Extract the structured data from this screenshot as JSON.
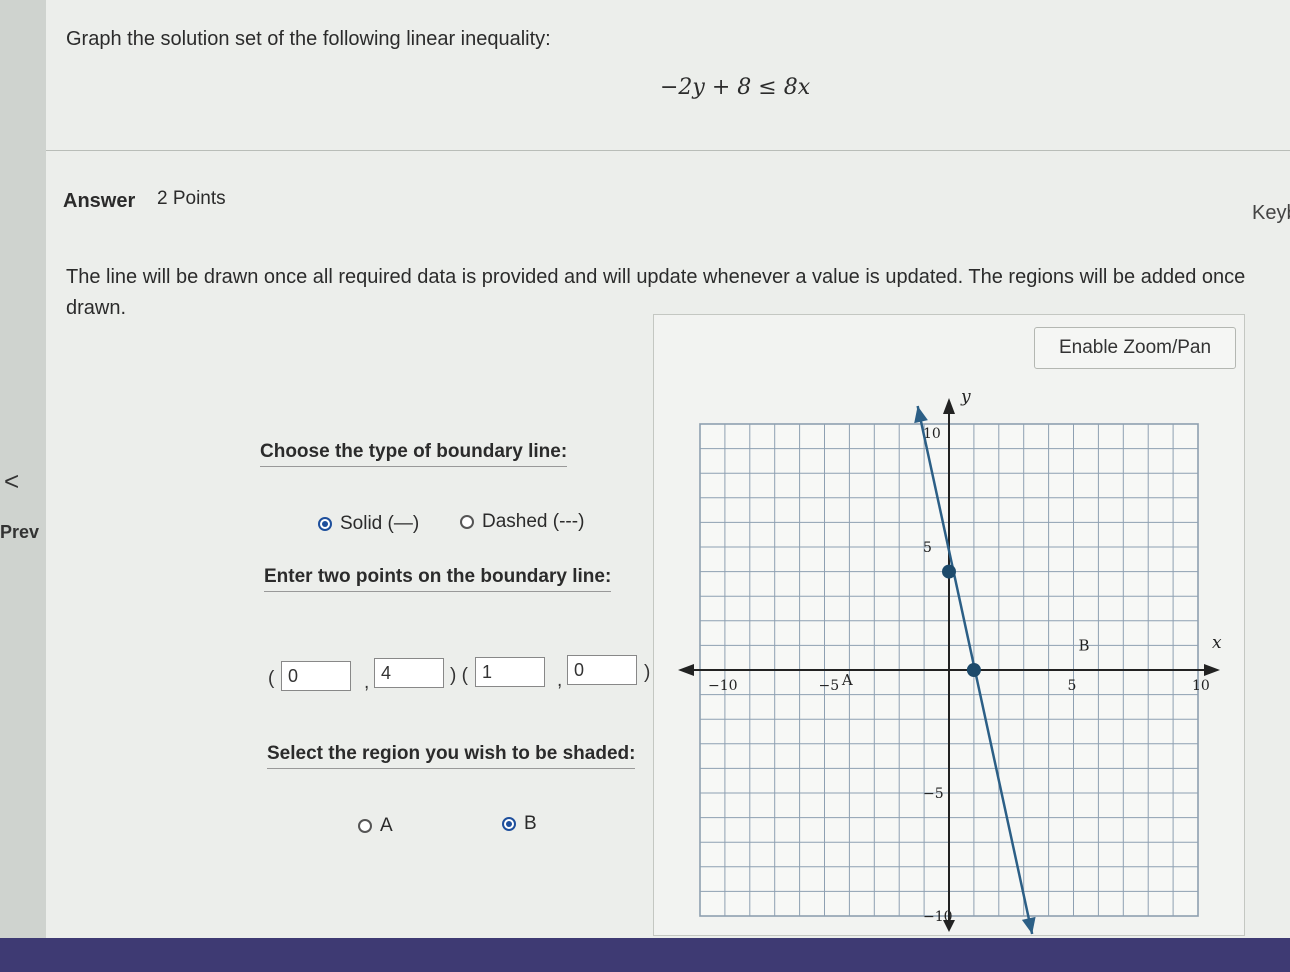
{
  "question": {
    "prompt": "Graph the solution set of the following linear inequality:",
    "inequality": "−2y + 8 ≤ 8x"
  },
  "answer": {
    "label": "Answer",
    "points": "2 Points",
    "key_link": "Keyb"
  },
  "instructions": "The line will be drawn once all required data is provided and will update whenever a value is updated. The regions will be added once drawn.",
  "nav": {
    "prev_arrow": "<",
    "prev_label": "Prev"
  },
  "graph_controls": {
    "zoom_button": "Enable Zoom/Pan"
  },
  "boundary": {
    "label": "Choose the type of boundary line:",
    "options": [
      {
        "label": "Solid (—)",
        "selected": true
      },
      {
        "label": "Dashed (---)",
        "selected": false
      }
    ]
  },
  "points_entry": {
    "label": "Enter two points on the boundary line:",
    "open1": "(",
    "comma": ",",
    "mid": ") (",
    "close": ")",
    "p1": {
      "x": "0",
      "y": "4"
    },
    "p2": {
      "x": "1",
      "y": "0"
    }
  },
  "region": {
    "label": "Select the region you wish to be shaded:",
    "options": [
      {
        "label": "A",
        "selected": false
      },
      {
        "label": "B",
        "selected": true
      }
    ]
  },
  "chart_data": {
    "type": "line",
    "xlabel": "x",
    "ylabel": "y",
    "xlim": [
      -10,
      10
    ],
    "ylim": [
      -10,
      10
    ],
    "grid": true,
    "x_ticks": [
      "−10",
      "−5",
      "5",
      "10"
    ],
    "y_ticks": [
      "10",
      "5",
      "−5",
      "−10"
    ],
    "line": {
      "style": "solid",
      "color": "#2c5f86",
      "through": [
        [
          0,
          4
        ],
        [
          1,
          0
        ]
      ]
    },
    "points": [
      {
        "x": 0,
        "y": 4
      },
      {
        "x": 1,
        "y": 0
      }
    ],
    "region_labels": [
      {
        "label": "A",
        "x": -4.3,
        "y": -0.6
      },
      {
        "label": "B",
        "x": 5.2,
        "y": 0.8
      }
    ]
  }
}
